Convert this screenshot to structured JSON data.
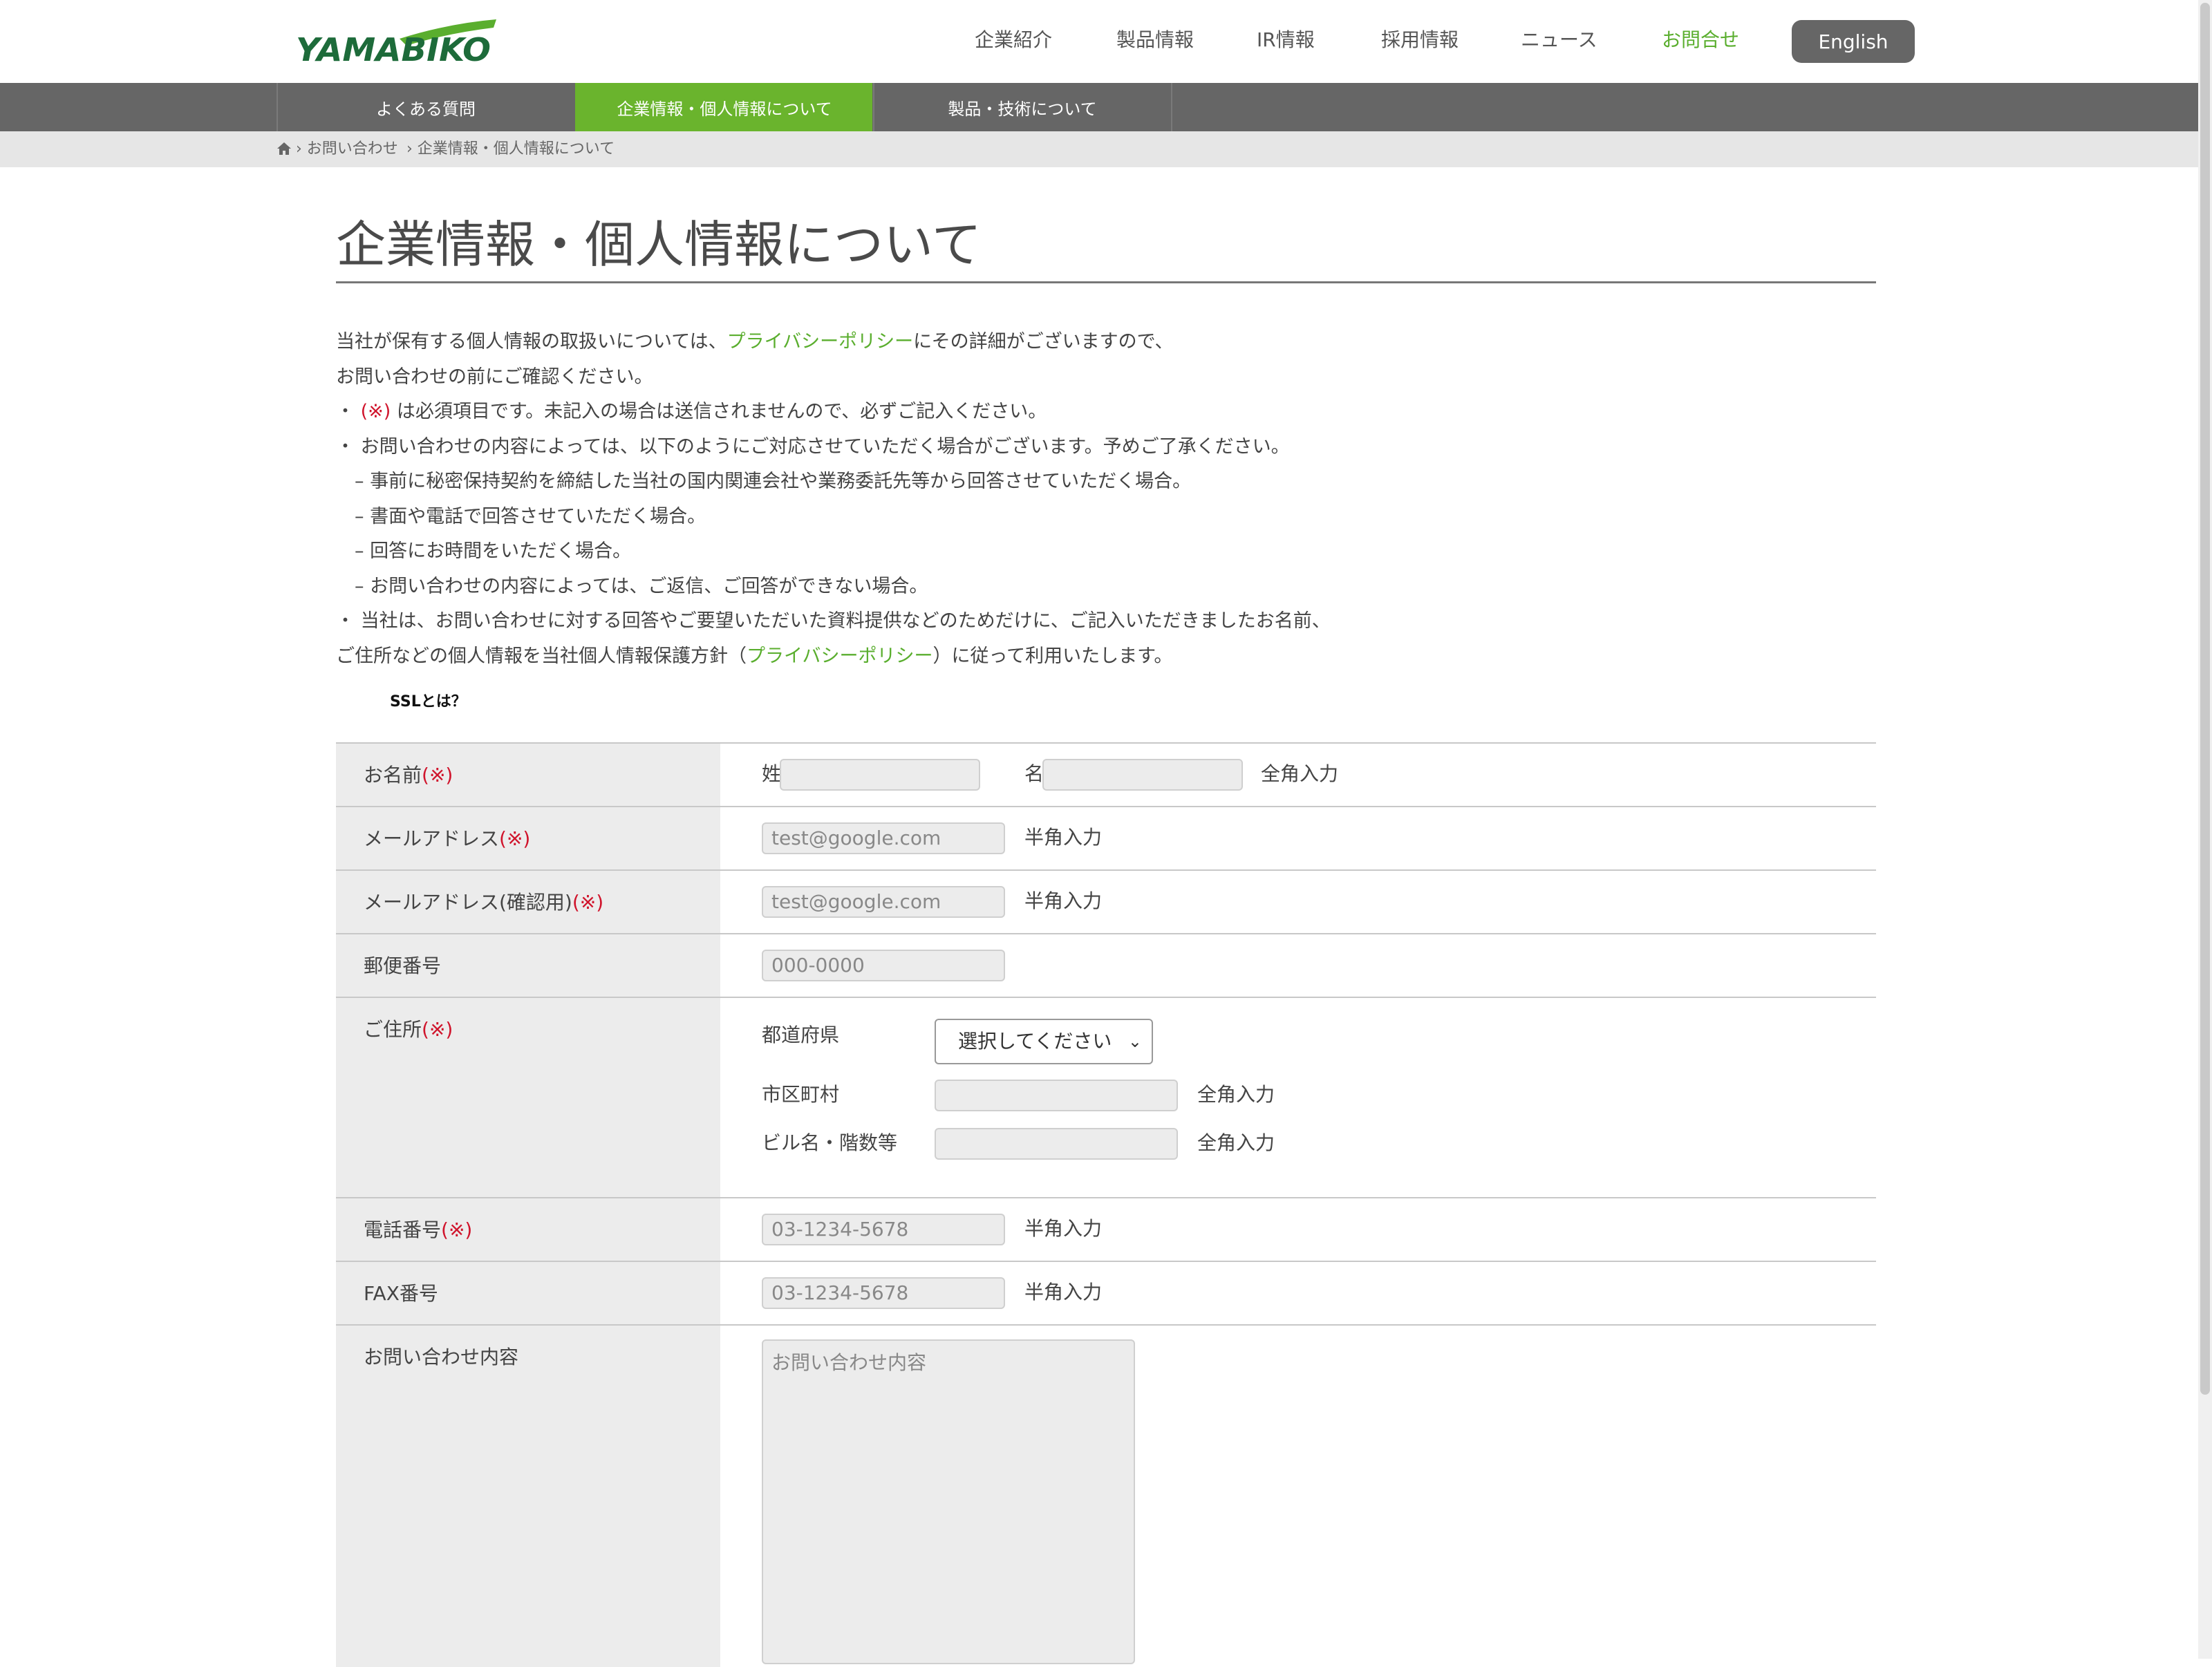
{
  "brand": {
    "logo_text": "YAMABIKO",
    "accent": "#5aae2e"
  },
  "nav": {
    "items": [
      "企業紹介",
      "製品情報",
      "IR情報",
      "採用情報",
      "ニュース",
      "お問合せ"
    ],
    "english_label": "English"
  },
  "subnav": {
    "items": [
      "よくある質問",
      "企業情報・個人情報について",
      "製品・技術について"
    ]
  },
  "breadcrumb": {
    "home_icon": "home-icon",
    "items": [
      "› お問い合わせ",
      "› 企業情報・個人情報について"
    ]
  },
  "page": {
    "title": "企業情報・個人情報について"
  },
  "intro": {
    "l1_a": "当社が保有する個人情報の取扱いについては、",
    "l1_link": "プライバシーポリシー",
    "l1_b": "にその詳細がございますので、",
    "l2": "お問い合わせの前にご確認ください。",
    "l3_bullet": "・ ",
    "l3_mark": "(※)",
    "l3_b": " は必須項目です。未記入の場合は送信されませんので、必ずご記入ください。",
    "l4": "・ お問い合わせの内容によっては、以下のようにご対応させていただく場合がございます。予めご了承ください。",
    "l5": "　– 事前に秘密保持契約を締結した当社の国内関連会社や業務委託先等から回答させていただく場合。",
    "l6": "　– 書面や電話で回答させていただく場合。",
    "l7": "　– 回答にお時間をいただく場合。",
    "l8": "　– お問い合わせの内容によっては、ご返信、ご回答ができない場合。",
    "l9": "・ 当社は、お問い合わせに対する回答やご要望いただいた資料提供などのためだけに、ご記入いただきましたお名前、",
    "l10_a": "ご住所などの個人情報を当社個人情報保護方針（",
    "l10_link": "プライバシーポリシー",
    "l10_b": "）に従って利用いたします。",
    "ssl": "SSLとは？"
  },
  "form": {
    "required_mark": "(※)",
    "name": {
      "label": "お名前",
      "last_label": "姓",
      "first_label": "名",
      "hint": "全角入力"
    },
    "email": {
      "label": "メールアドレス",
      "placeholder": "test@google.com",
      "hint": "半角入力"
    },
    "email_confirm": {
      "label": "メールアドレス(確認用)",
      "placeholder": "test@google.com",
      "hint": "半角入力"
    },
    "postal": {
      "label": "郵便番号",
      "placeholder": "000-0000"
    },
    "address": {
      "label": "ご住所",
      "prefecture_label": "都道府県",
      "prefecture_value": "選択してください",
      "city_label": "市区町村",
      "city_hint": "全角入力",
      "building_label": "ビル名・階数等",
      "building_hint": "全角入力"
    },
    "phone": {
      "label": "電話番号",
      "placeholder": "03-1234-5678",
      "hint": "半角入力"
    },
    "fax": {
      "label": "FAX番号",
      "placeholder": "03-1234-5678",
      "hint": "半角入力"
    },
    "message": {
      "label": "お問い合わせ内容",
      "placeholder": "お問い合わせ内容"
    }
  }
}
